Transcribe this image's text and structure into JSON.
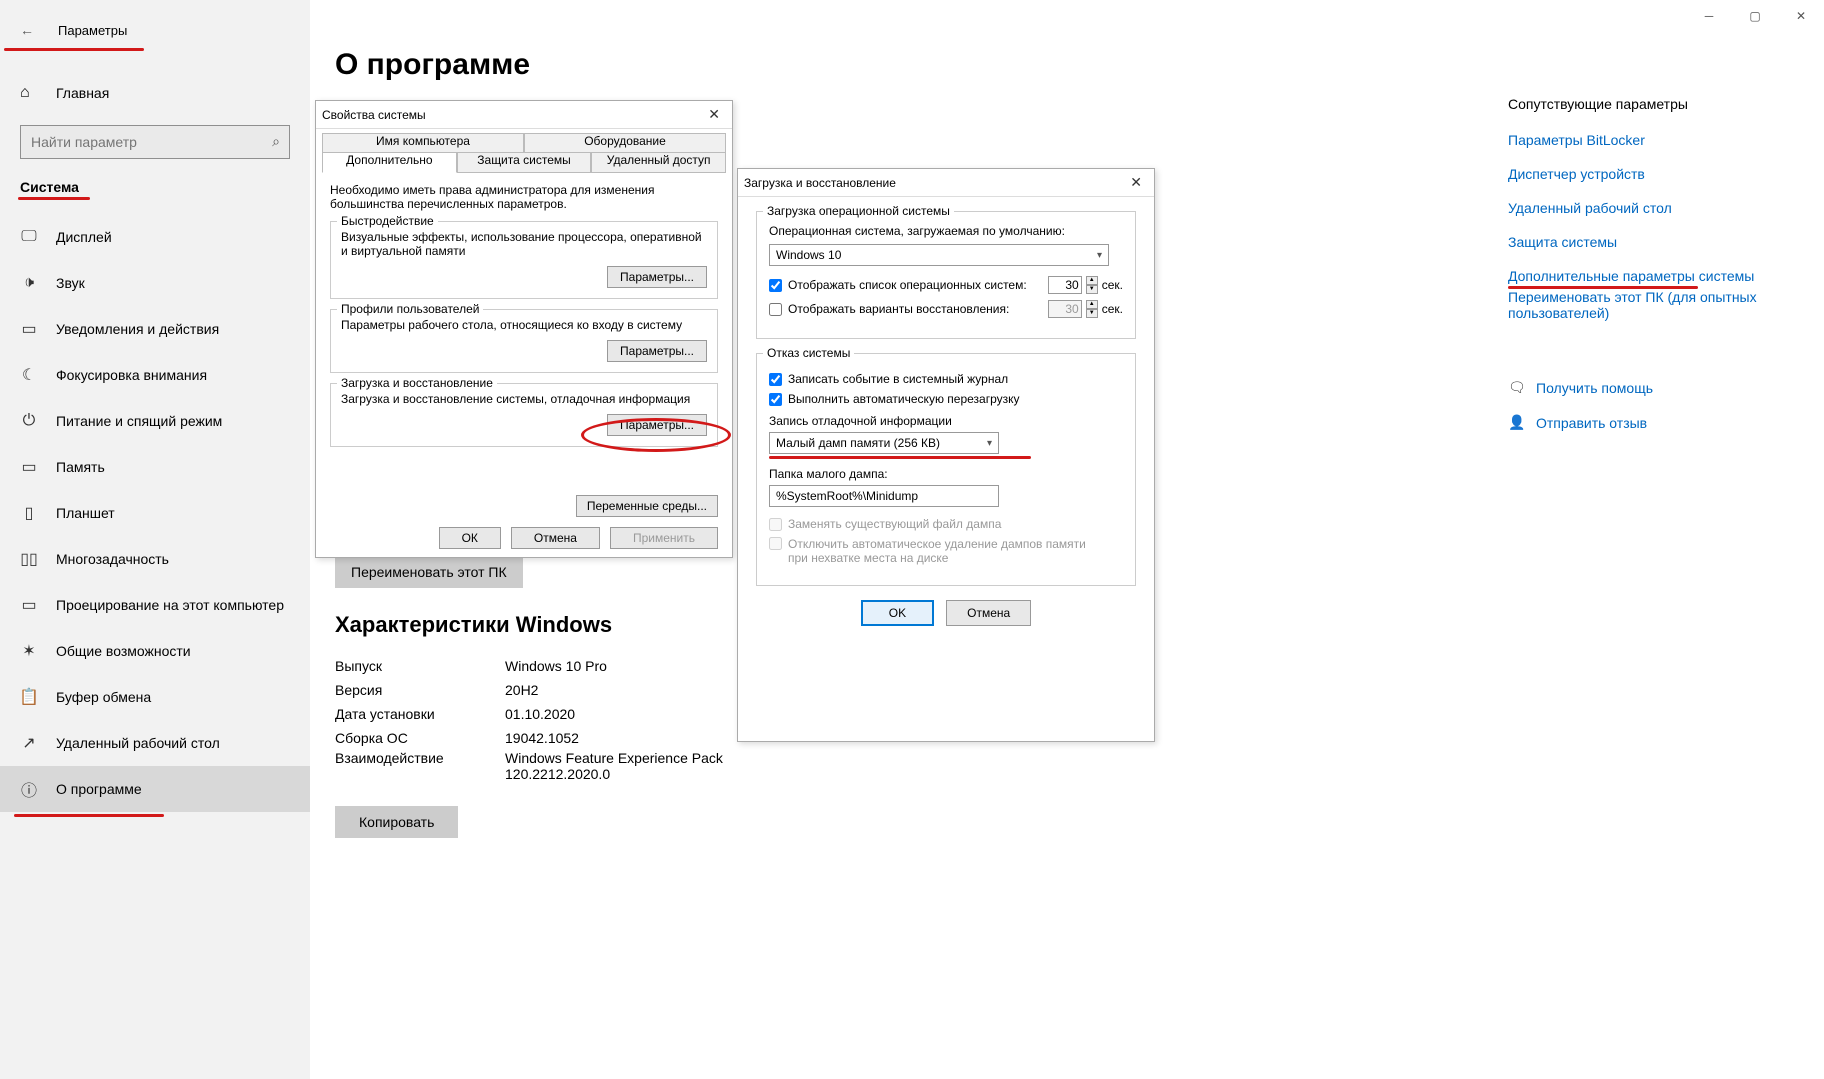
{
  "window": {
    "title": "Параметры"
  },
  "sidebar": {
    "home": "Главная",
    "search_placeholder": "Найти параметр",
    "section": "Система",
    "items": [
      {
        "label": "Дисплей",
        "icon": "🖵"
      },
      {
        "label": "Звук",
        "icon": "🔊"
      },
      {
        "label": "Уведомления и действия",
        "icon": "💬"
      },
      {
        "label": "Фокусировка внимания",
        "icon": "🌙"
      },
      {
        "label": "Питание и спящий режим",
        "icon": "⏻"
      },
      {
        "label": "Память",
        "icon": "▭"
      },
      {
        "label": "Планшет",
        "icon": "▭"
      },
      {
        "label": "Многозадачность",
        "icon": "▯▯"
      },
      {
        "label": "Проецирование на этот компьютер",
        "icon": "▭→"
      },
      {
        "label": "Общие возможности",
        "icon": "✶"
      },
      {
        "label": "Буфер обмена",
        "icon": "📋"
      },
      {
        "label": "Удаленный рабочий стол",
        "icon": "🖧"
      },
      {
        "label": "О программе",
        "icon": "ⓘ"
      }
    ]
  },
  "main": {
    "title": "О программе",
    "rename_btn": "Переименовать этот ПК",
    "specs_title": "Характеристики Windows",
    "specs": [
      {
        "k": "Выпуск",
        "v": "Windows 10 Pro"
      },
      {
        "k": "Версия",
        "v": "20H2"
      },
      {
        "k": "Дата установки",
        "v": "01.10.2020"
      },
      {
        "k": "Сборка ОС",
        "v": "19042.1052"
      },
      {
        "k": "Взаимодействие",
        "v": "Windows Feature Experience Pack 120.2212.2020.0"
      }
    ],
    "copy_btn": "Копировать"
  },
  "rightcol": {
    "title": "Сопутствующие параметры",
    "links": [
      "Параметры BitLocker",
      "Диспетчер устройств",
      "Удаленный рабочий стол",
      "Защита системы",
      "Дополнительные параметры системы",
      "Переименовать этот ПК (для опытных пользователей)"
    ],
    "help": "Получить помощь",
    "feedback": "Отправить отзыв"
  },
  "sysprops": {
    "title": "Свойства системы",
    "tabs_top": [
      "Имя компьютера",
      "Оборудование"
    ],
    "tabs_bot": [
      "Дополнительно",
      "Защита системы",
      "Удаленный доступ"
    ],
    "note": "Необходимо иметь права администратора для изменения большинства перечисленных параметров.",
    "perf_legend": "Быстродействие",
    "perf_desc": "Визуальные эффекты, использование процессора, оперативной и виртуальной памяти",
    "profiles_legend": "Профили пользователей",
    "profiles_desc": "Параметры рабочего стола, относящиеся ко входу в систему",
    "startup_legend": "Загрузка и восстановление",
    "startup_desc": "Загрузка и восстановление системы, отладочная информация",
    "params_btn": "Параметры...",
    "env_btn": "Переменные среды...",
    "ok": "ОК",
    "cancel": "Отмена",
    "apply": "Применить"
  },
  "startdlg": {
    "title": "Загрузка и восстановление",
    "boot_legend": "Загрузка операционной системы",
    "default_os_label": "Операционная система, загружаемая по умолчанию:",
    "default_os": "Windows 10",
    "show_list": "Отображать список операционных систем:",
    "show_list_value": "30",
    "show_recovery": "Отображать варианты восстановления:",
    "show_recovery_value": "30",
    "sec": "сек.",
    "failure_legend": "Отказ системы",
    "log_event": "Записать событие в системный журнал",
    "auto_restart": "Выполнить автоматическую перезагрузку",
    "dump_label": "Запись отладочной информации",
    "dump_value": "Малый дамп памяти (256 КВ)",
    "folder_label": "Папка малого дампа:",
    "folder_value": "%SystemRoot%\\Minidump",
    "overwrite": "Заменять существующий файл дампа",
    "disable_autodelete": "Отключить автоматическое удаление дампов памяти при нехватке места на диске",
    "ok": "OK",
    "cancel": "Отмена"
  }
}
